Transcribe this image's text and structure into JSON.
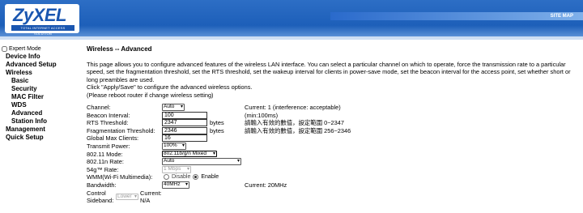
{
  "header": {
    "logo_text": "ZyXEL",
    "logo_tagline": "TOTAL INTERNET ACCESS SOLUTION",
    "site_map": "SITE MAP"
  },
  "sidebar": {
    "expert_mode": "Expert Mode",
    "items": [
      {
        "label": "Device Info"
      },
      {
        "label": "Advanced Setup"
      },
      {
        "label": "Wireless"
      },
      {
        "label": "Basic"
      },
      {
        "label": "Security"
      },
      {
        "label": "MAC Filter"
      },
      {
        "label": "WDS"
      },
      {
        "label": "Advanced"
      },
      {
        "label": "Station Info"
      },
      {
        "label": "Management"
      },
      {
        "label": "Quick Setup"
      }
    ]
  },
  "page": {
    "title": "Wireless -- Advanced",
    "description": "This page allows you to configure advanced features of the wireless LAN interface. You can select a particular channel on which to operate, force the transmission rate to a particular speed, set the fragmentation threshold, set the RTS threshold, set the wakeup interval for clients in power-save mode, set the beacon interval for the access point, set whether short or long preambles are used.",
    "apply_hint": "Click \"Apply/Save\" to configure the advanced wireless options.",
    "reboot_hint": "(Please reboot router if change wireless setting)"
  },
  "form": {
    "channel": {
      "label": "Channel:",
      "value": "Auto",
      "info": "Current: 1 (interference: acceptable)"
    },
    "beacon": {
      "label": "Beacon Interval:",
      "value": "100",
      "info": "(min:100ms)"
    },
    "rts": {
      "label": "RTS Threshold:",
      "value": "2347",
      "unit": "bytes",
      "info": "請輸入有效的數值，設定範圍 0~2347"
    },
    "frag": {
      "label": "Fragmentation Threshold:",
      "value": "2346",
      "unit": "bytes",
      "info": "請輸入有效的數值，設定範圍 256~2346"
    },
    "max_clients": {
      "label": "Global Max Clients:",
      "value": "16"
    },
    "tx_power": {
      "label": "Transmit Power:",
      "value": "100%"
    },
    "mode": {
      "label": "802.11 Mode:",
      "value": "802.11b/g/n Mixed"
    },
    "n_rate": {
      "label": "802.11n Rate:",
      "value": "Auto"
    },
    "g_rate": {
      "label": "54g™ Rate:",
      "value": "1 Mbps"
    },
    "wmm": {
      "label": "WMM(Wi-Fi Multimedia):",
      "disable": "Disable",
      "enable": "Enable"
    },
    "bandwidth": {
      "label": "Bandwidth:",
      "value": "40MHz",
      "info": "Current: 20MHz"
    },
    "control_sideband": {
      "label_line1": "Control",
      "label_line2": "Sideband:",
      "value": "Lower",
      "current_label": "Current:",
      "current_value": "N/A"
    }
  },
  "colors": {
    "header_blue": "#1d5fb9",
    "band": "#cfdff3"
  }
}
